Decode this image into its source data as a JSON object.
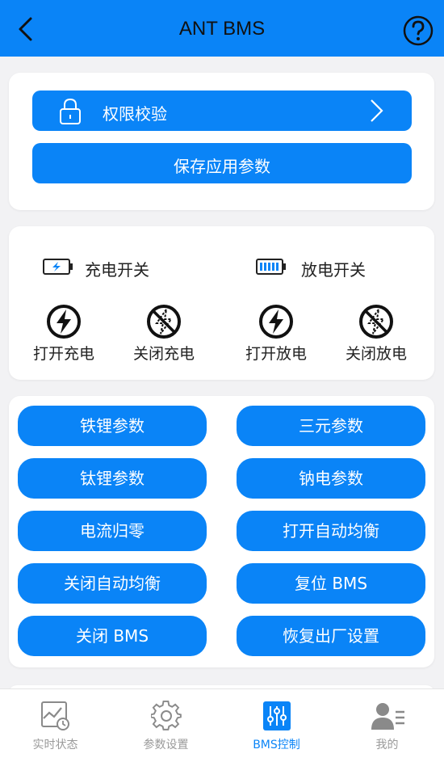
{
  "header": {
    "title": "ANT BMS"
  },
  "permission": {
    "label": "权限校验"
  },
  "save": {
    "label": "保存应用参数"
  },
  "switches": {
    "charge_title": "充电开关",
    "discharge_title": "放电开关",
    "open_charge": "打开充电",
    "close_charge": "关闭充电",
    "open_discharge": "打开放电",
    "close_discharge": "关闭放电"
  },
  "grid": [
    "铁锂参数",
    "三元参数",
    "钛锂参数",
    "钠电参数",
    "电流归零",
    "打开自动均衡",
    "关闭自动均衡",
    "复位 BMS",
    "关闭 BMS",
    "恢复出厂设置"
  ],
  "nav": [
    {
      "label": "实时状态",
      "icon": "realtime-chart-icon"
    },
    {
      "label": "参数设置",
      "icon": "gear-icon"
    },
    {
      "label": "BMS控制",
      "icon": "sliders-icon"
    },
    {
      "label": "我的",
      "icon": "user-icon"
    }
  ],
  "colors": {
    "primary": "#0a84f7",
    "background": "#f2f2f4",
    "inactive": "#9a9a9a"
  }
}
